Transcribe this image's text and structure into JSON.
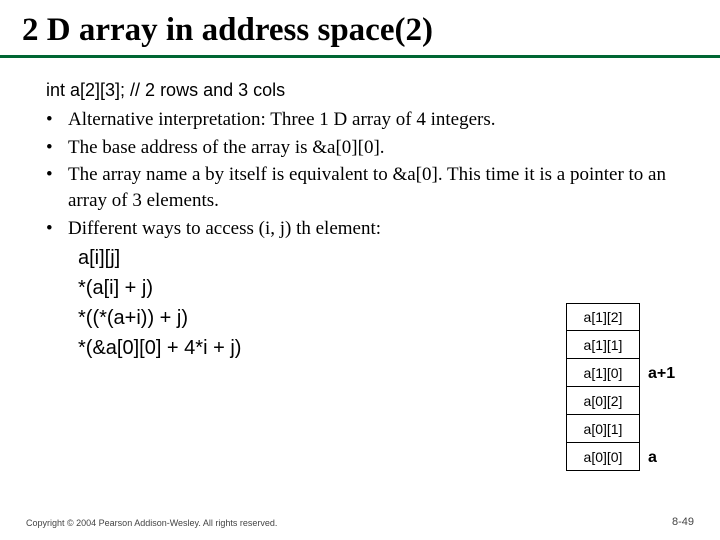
{
  "title": "2 D array in address space(2)",
  "declaration": "int a[2][3];  // 2 rows and 3 cols",
  "bullets": [
    "Alternative interpretation: Three 1 D array of 4 integers.",
    "The base address of the array is &a[0][0].",
    "The array name a by itself is equivalent to &a[0]. This time it is a pointer to an array of 3 elements.",
    "Different ways to access (i, j) th element:"
  ],
  "access": [
    "a[i][j]",
    "*(a[i] + j)",
    "*((*(a+i)) + j)",
    "*(&a[0][0] + 4*i + j)"
  ],
  "cells": [
    "a[1][2]",
    "a[1][1]",
    "a[1][0]",
    "a[0][2]",
    "a[0][1]",
    "a[0][0]"
  ],
  "side_labels": {
    "aplus1": "a+1",
    "a": "a"
  },
  "footer": {
    "copyright": "Copyright © 2004 Pearson Addison-Wesley. All rights reserved.",
    "page": "8-49"
  }
}
